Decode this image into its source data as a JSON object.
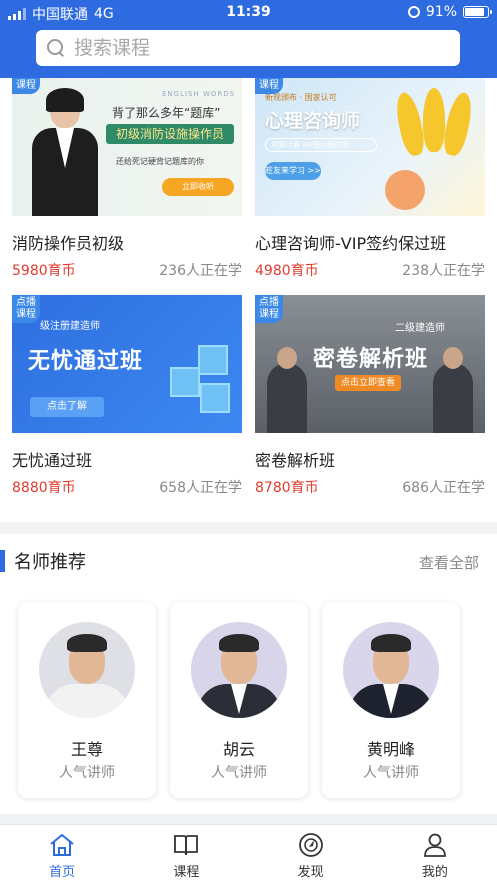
{
  "status_bar": {
    "carrier": "中国联通",
    "network": "4G",
    "time": "11:39",
    "battery": "91%",
    "battery_level": 0.91
  },
  "search": {
    "placeholder": "搜索课程"
  },
  "courses": [
    {
      "tag": "课程",
      "title": "消防操作员初级",
      "price": "5980育币",
      "learners": "236人正在学",
      "banner": {
        "line1": "背了那么多年“题库”",
        "line2": "初级消防设施操作员",
        "line3": "还给死记硬背记题库的你",
        "button": "立即收听",
        "english": "ENGLISH WORDS"
      }
    },
    {
      "tag": "课程",
      "title": "心理咨询师-VIP签约保过班",
      "price": "4980育币",
      "learners": "238人正在学",
      "banner": {
        "sub": "新规颁布 · 国家认可",
        "big": "心理咨询师",
        "pill": "时薪计算  VIP签约保过班",
        "button": "趁友来学习 >>"
      }
    },
    {
      "tag": "点播\n课程",
      "title": "无忧通过班",
      "price": "8880育币",
      "learners": "658人正在学",
      "banner": {
        "sub": "级注册建造师",
        "big": "无忧通过班",
        "button": "点击了解"
      }
    },
    {
      "tag": "点播\n课程",
      "title": "密卷解析班",
      "price": "8780育币",
      "learners": "686人正在学",
      "banner": {
        "sub": "二级建造师",
        "big": "密卷解析班",
        "button": "点击立即查看"
      }
    }
  ],
  "teachers_section": {
    "title": "名师推荐",
    "see_all": "查看全部",
    "teachers": [
      {
        "name": "王尊",
        "role": "人气讲师"
      },
      {
        "name": "胡云",
        "role": "人气讲师"
      },
      {
        "name": "黄明峰",
        "role": "人气讲师"
      }
    ]
  },
  "tabbar": {
    "items": [
      {
        "label": "首页",
        "icon": "home-icon",
        "active": true
      },
      {
        "label": "课程",
        "icon": "book-icon",
        "active": false
      },
      {
        "label": "发现",
        "icon": "compass-icon",
        "active": false
      },
      {
        "label": "我的",
        "icon": "user-icon",
        "active": false
      }
    ]
  },
  "colors": {
    "brand": "#2f6be0",
    "price": "#e23b2e",
    "muted": "#888888"
  }
}
